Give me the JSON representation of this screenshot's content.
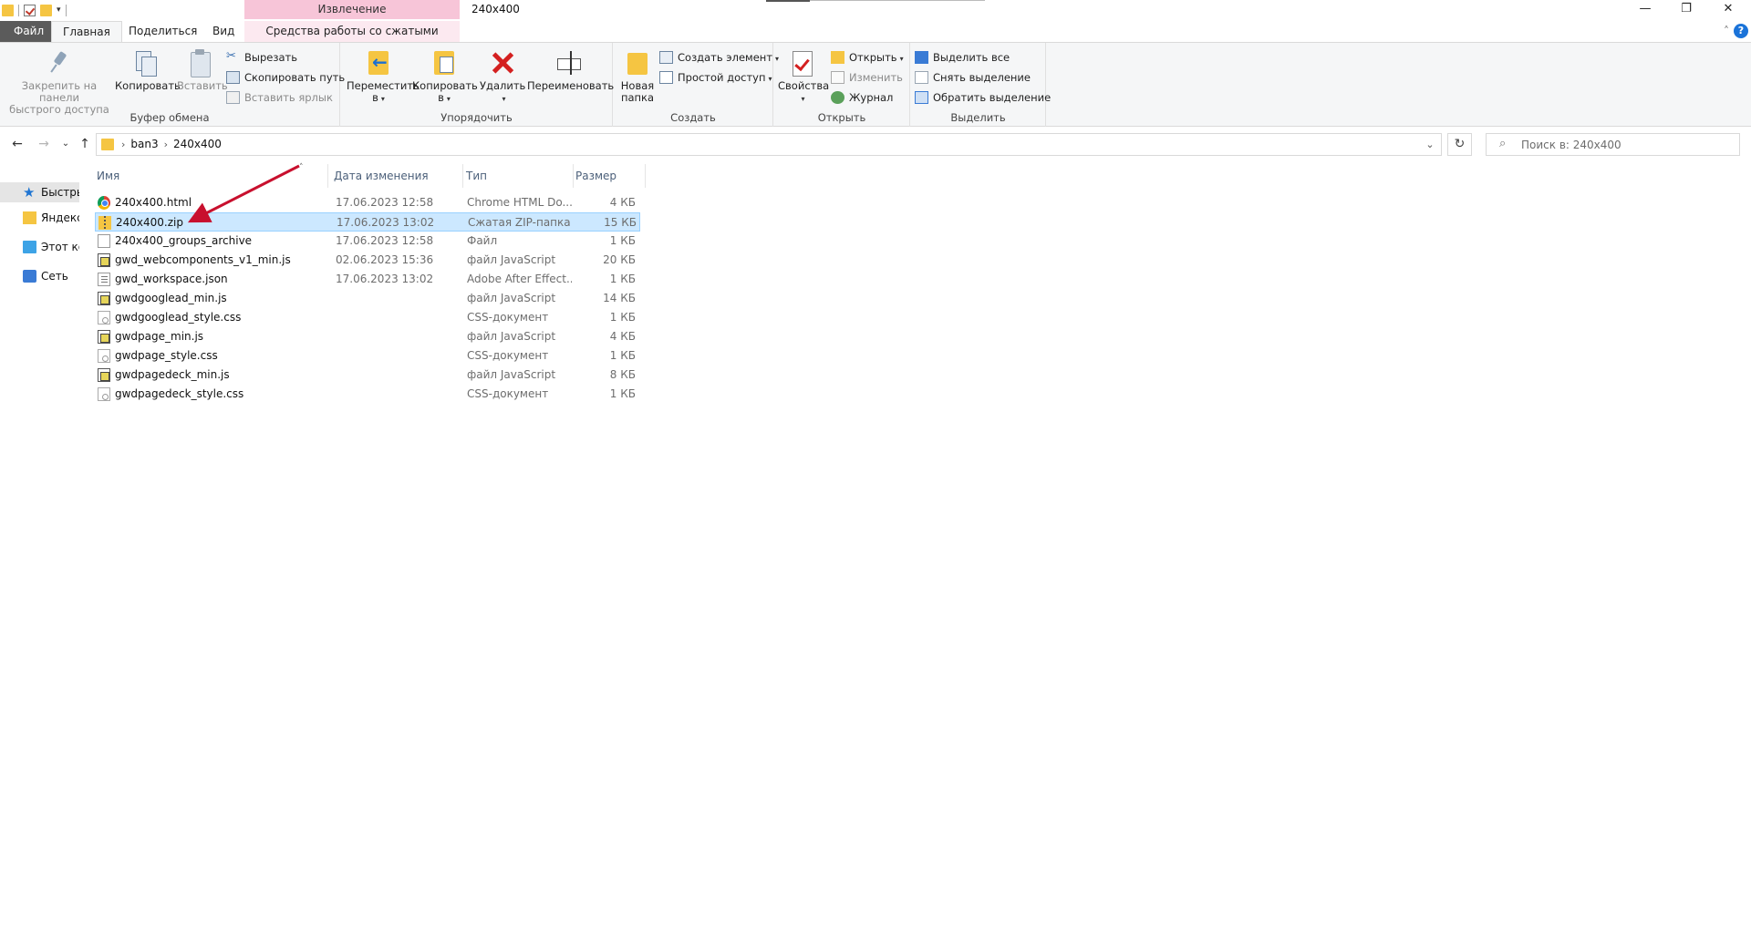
{
  "window": {
    "title": "240x400",
    "context_tab_header": "Извлечение",
    "controls": {
      "minimize": "—",
      "restore": "❐",
      "close": "✕"
    }
  },
  "tabs": {
    "file": "Файл",
    "home": "Главная",
    "share": "Поделиться",
    "view": "Вид",
    "context": "Средства работы со сжатыми папками"
  },
  "ribbon": {
    "clipboard": {
      "group": "Буфер обмена",
      "pin_line1": "Закрепить на панели",
      "pin_line2": "быстрого доступа",
      "copy": "Копировать",
      "paste": "Вставить",
      "cut": "Вырезать",
      "copy_path": "Скопировать путь",
      "paste_shortcut": "Вставить ярлык"
    },
    "organize": {
      "group": "Упорядочить",
      "move_line1": "Переместить",
      "move_line2": "в",
      "copy_line1": "Копировать",
      "copy_line2": "в",
      "delete": "Удалить",
      "rename": "Переименовать"
    },
    "new": {
      "group": "Создать",
      "folder_line1": "Новая",
      "folder_line2": "папка",
      "new_item": "Создать элемент",
      "easy_access": "Простой доступ"
    },
    "open": {
      "group": "Открыть",
      "properties": "Свойства",
      "open": "Открыть",
      "edit": "Изменить",
      "history": "Журнал"
    },
    "select": {
      "group": "Выделить",
      "select_all": "Выделить все",
      "select_none": "Снять выделение",
      "invert": "Обратить выделение"
    }
  },
  "address": {
    "crumbs": [
      "ban3",
      "240x400"
    ]
  },
  "search": {
    "placeholder": "Поиск в: 240x400"
  },
  "navpane": {
    "items": [
      "Быстрый доступ",
      "Яндекс.Диск",
      "Этот компьютер",
      "Сеть"
    ]
  },
  "columns": {
    "name": "Имя",
    "date": "Дата изменения",
    "type": "Тип",
    "size": "Размер"
  },
  "files": [
    {
      "name": "240x400.html",
      "date": "17.06.2023 12:58",
      "type": "Chrome HTML Do...",
      "size": "4 КБ",
      "icon": "chrome-html-icon"
    },
    {
      "name": "240x400.zip",
      "date": "17.06.2023 13:02",
      "type": "Сжатая ZIP-папка",
      "size": "15 КБ",
      "icon": "zip-folder-icon",
      "selected": true
    },
    {
      "name": "240x400_groups_archive",
      "date": "17.06.2023 12:58",
      "type": "Файл",
      "size": "1 КБ",
      "icon": "blank-file-icon"
    },
    {
      "name": "gwd_webcomponents_v1_min.js",
      "date": "02.06.2023 15:36",
      "type": "файл JavaScript",
      "size": "20 КБ",
      "icon": "js-file-icon"
    },
    {
      "name": "gwd_workspace.json",
      "date": "17.06.2023 13:02",
      "type": "Adobe After Effect...",
      "size": "1 КБ",
      "icon": "json-file-icon"
    },
    {
      "name": "gwdgooglead_min.js",
      "date": "",
      "type": "файл JavaScript",
      "size": "14 КБ",
      "icon": "js-file-icon"
    },
    {
      "name": "gwdgooglead_style.css",
      "date": "",
      "type": "CSS-документ",
      "size": "1 КБ",
      "icon": "css-file-icon"
    },
    {
      "name": "gwdpage_min.js",
      "date": "",
      "type": "файл JavaScript",
      "size": "4 КБ",
      "icon": "js-file-icon"
    },
    {
      "name": "gwdpage_style.css",
      "date": "",
      "type": "CSS-документ",
      "size": "1 КБ",
      "icon": "css-file-icon"
    },
    {
      "name": "gwdpagedeck_min.js",
      "date": "",
      "type": "файл JavaScript",
      "size": "8 КБ",
      "icon": "js-file-icon"
    },
    {
      "name": "gwdpagedeck_style.css",
      "date": "",
      "type": "CSS-документ",
      "size": "1 КБ",
      "icon": "css-file-icon"
    }
  ],
  "colors": {
    "selection_bg": "#cce8ff",
    "selection_border": "#99d1ff",
    "context_tab": "#f7c5d8",
    "annotation_arrow": "#c8102e"
  }
}
